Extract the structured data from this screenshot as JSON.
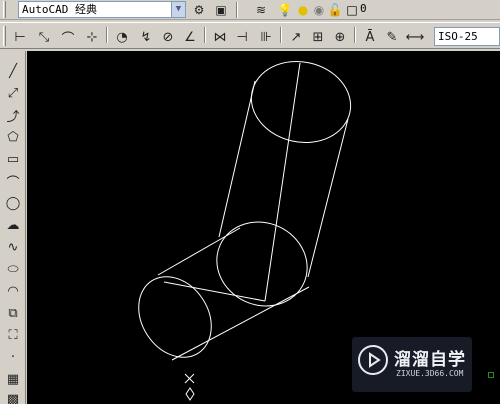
{
  "workspace": {
    "selected": "AutoCAD 经典"
  },
  "layer": {
    "current": "0"
  },
  "dim_style": {
    "current": "ISO-25"
  },
  "watermark": {
    "title": "溜溜自学",
    "url": "ZIXUE.3D66.COM"
  },
  "icons": {
    "top": [
      "workspace-settings-icon",
      "workspace-save-icon",
      "layer-manager-icon",
      "layer-on-icon",
      "layer-freeze-icon",
      "layer-color-icon",
      "layer-lock-icon",
      "layer-color-square-icon"
    ],
    "dimension": [
      "linear-dim-icon",
      "aligned-dim-icon",
      "arc-length-dim-icon",
      "ordinate-dim-icon",
      "radius-dim-icon",
      "jogged-dim-icon",
      "diameter-dim-icon",
      "angular-dim-icon",
      "quick-dim-icon",
      "baseline-dim-icon",
      "continue-dim-icon",
      "quick-leader-icon",
      "tolerance-icon",
      "center-mark-icon",
      "dimension-edit-icon",
      "dimension-text-edit-icon",
      "dimension-update-icon"
    ],
    "draw": [
      "line-icon",
      "construction-line-icon",
      "polyline-icon",
      "polygon-icon",
      "rectangle-icon",
      "arc-icon",
      "circle-icon",
      "revision-cloud-icon",
      "spline-icon",
      "ellipse-icon",
      "ellipse-arc-icon",
      "insert-block-icon",
      "make-block-icon",
      "point-icon",
      "hatch-icon",
      "gradient-icon"
    ]
  }
}
